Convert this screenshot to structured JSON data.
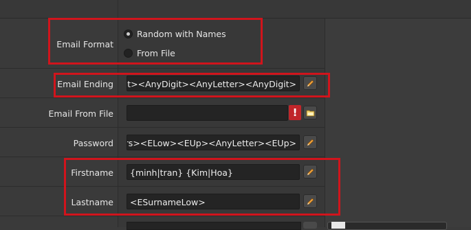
{
  "fields": {
    "email_format": {
      "label": "Email Format",
      "options": [
        {
          "label": "Random with Names",
          "selected": true
        },
        {
          "label": "From File",
          "selected": false
        }
      ]
    },
    "email_ending": {
      "label": "Email Ending",
      "value": "<AnyDigit><AnyDigit><AnyDigit><AnyLetter><AnyDigit>"
    },
    "email_from_file": {
      "label": "Email From File",
      "value": "",
      "error_icon": "!"
    },
    "password": {
      "label": "Password",
      "value": "<ENumbers><ELow><EUp><AnyLetter><EUp>"
    },
    "firstname": {
      "label": "Firstname",
      "value": "{minh|tran} {Kim|Hoa}"
    },
    "lastname": {
      "label": "Lastname",
      "value": "<ESurnameLow>"
    }
  },
  "icons": {
    "edit": "pencil-icon",
    "browse": "folder-icon",
    "error": "error-icon"
  },
  "colors": {
    "highlight": "#d1141c",
    "error": "#c0262a",
    "input_bg": "#242424",
    "panel_bg": "#3a3a3a"
  }
}
